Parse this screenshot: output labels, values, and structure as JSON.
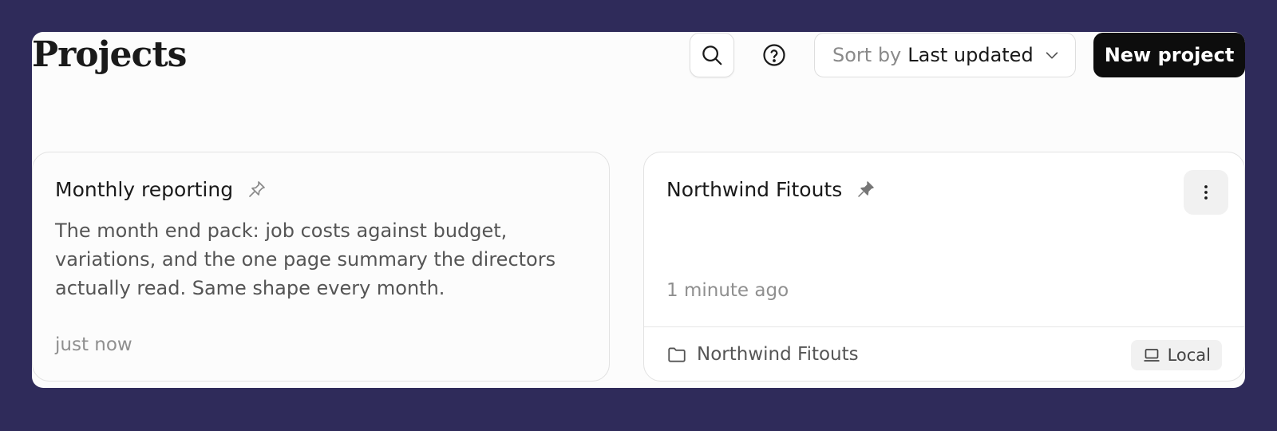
{
  "header": {
    "title": "Projects",
    "sort_label": "Sort by",
    "sort_value": "Last updated",
    "new_project_label": "New project"
  },
  "icons": {
    "search": "search-icon",
    "help": "help-circle-icon",
    "chevron": "chevron-down-icon",
    "pin": "pin-icon",
    "menu": "more-vertical-icon",
    "folder": "folder-icon",
    "laptop": "laptop-icon"
  },
  "projects": [
    {
      "title": "Monthly reporting",
      "pinned": false,
      "description": "The month end pack: job costs against budget, variations, and the one page summary the directors actually read. Same shape every month.",
      "updated": "just now"
    },
    {
      "title": "Northwind Fitouts",
      "pinned": true,
      "description": "",
      "updated": "1 minute ago",
      "folder": "Northwind Fitouts",
      "location": "Local"
    }
  ],
  "colors": {
    "backdrop": "#2f2b5a",
    "primary_button": "#0d0d0d",
    "surface": "#fcfcfc"
  }
}
